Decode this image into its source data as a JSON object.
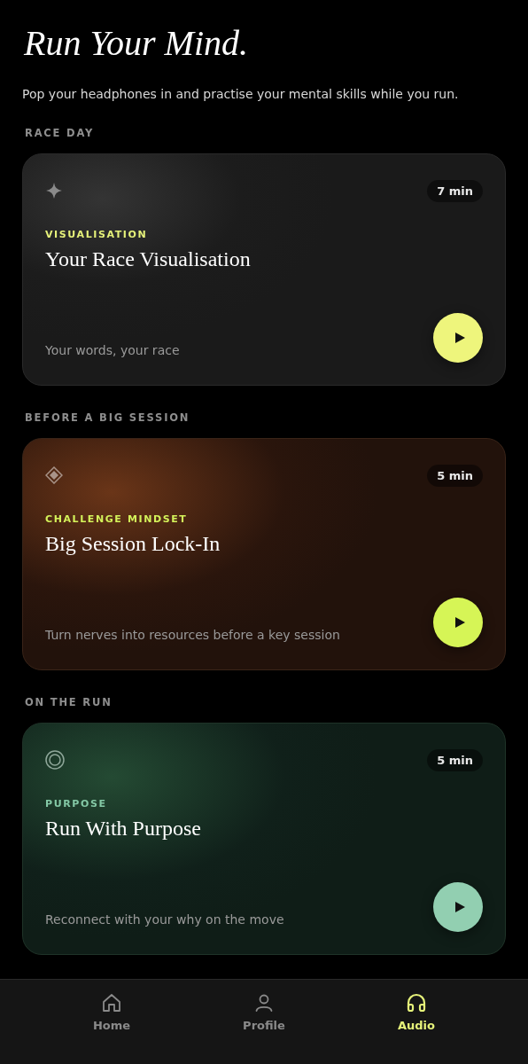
{
  "header": {
    "title": "Run Your Mind.",
    "subtitle": "Pop your headphones in and practise your mental skills while you run."
  },
  "sections": [
    {
      "label": "RACE DAY",
      "card": {
        "kind": "neutral",
        "duration": "7 min",
        "category": "VISUALISATION",
        "title": "Your Race Visualisation",
        "description": "Your words, your race"
      }
    },
    {
      "label": "BEFORE A BIG SESSION",
      "card": {
        "kind": "ember",
        "duration": "5 min",
        "category": "CHALLENGE MINDSET",
        "title": "Big Session Lock-In",
        "description": "Turn nerves into resources before a key session"
      }
    },
    {
      "label": "ON THE RUN",
      "card": {
        "kind": "forest",
        "duration": "5 min",
        "category": "PURPOSE",
        "title": "Run With Purpose",
        "description": "Reconnect with your why on the move"
      }
    }
  ],
  "nav": [
    {
      "label": "Home",
      "selected": false
    },
    {
      "label": "Profile",
      "selected": false
    },
    {
      "label": "Audio",
      "selected": true
    }
  ]
}
